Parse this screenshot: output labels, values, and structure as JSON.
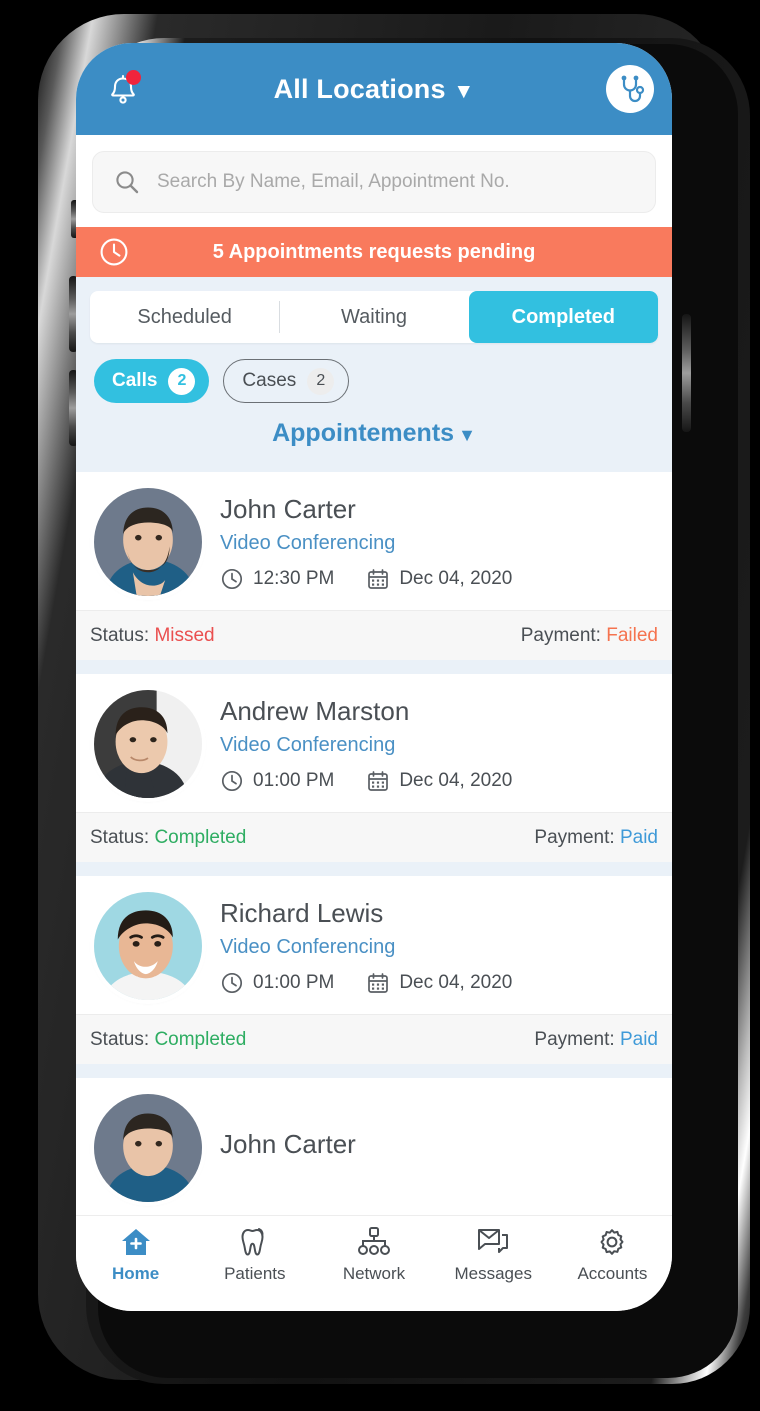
{
  "header": {
    "title": "All Locations",
    "caret": "▼",
    "bell_icon": "bell-icon",
    "logo_icon": "stethoscope-logo-icon"
  },
  "search": {
    "placeholder": "Search By Name, Email, Appointment No.",
    "value": "",
    "icon": "search-icon"
  },
  "pending_banner": {
    "count": "5",
    "text": "Appointments requests pending",
    "full_text": "5 Appointments requests pending",
    "icon": "clock-icon",
    "color": "#F97A5D"
  },
  "tabs": [
    {
      "label": "Scheduled",
      "active": false
    },
    {
      "label": "Waiting",
      "active": false
    },
    {
      "label": "Completed",
      "active": true
    }
  ],
  "chips": [
    {
      "label": "Calls",
      "badge": "2",
      "active": true
    },
    {
      "label": "Cases",
      "badge": "2",
      "active": false
    }
  ],
  "section": {
    "label": "Appointements",
    "caret": "▼"
  },
  "appointments": [
    {
      "name": "John Carter",
      "type": "Video Conferencing",
      "time": "12:30 PM",
      "date": "Dec 04, 2020",
      "status_label": "Status:",
      "status_value": "Missed",
      "status_class": "status-missed",
      "payment_label": "Payment:",
      "payment_value": "Failed",
      "payment_class": "pay-failed",
      "avatar_bg": "#6e7a8c",
      "avatar_skin": "#e9c4a8",
      "avatar_hair": "#2c2620",
      "avatar_shirt": "#1f5f86"
    },
    {
      "name": "Andrew Marston",
      "type": "Video Conferencing",
      "time": "01:00 PM",
      "date": "Dec 04, 2020",
      "status_label": "Status:",
      "status_value": "Completed",
      "status_class": "status-completed",
      "payment_label": "Payment:",
      "payment_value": "Paid",
      "payment_class": "pay-paid",
      "avatar_bg": "#3c3c3c",
      "avatar_skin": "#ecc9ad",
      "avatar_hair": "#2a211a",
      "avatar_shirt": "#2f3338"
    },
    {
      "name": "Richard Lewis",
      "type": "Video Conferencing",
      "time": "01:00 PM",
      "date": "Dec 04, 2020",
      "status_label": "Status:",
      "status_value": "Completed",
      "status_class": "status-completed",
      "payment_label": "Payment:",
      "payment_value": "Paid",
      "payment_class": "pay-paid",
      "avatar_bg": "#9fd8e3",
      "avatar_skin": "#e8b795",
      "avatar_hair": "#241c16",
      "avatar_shirt": "#f4f4f4"
    },
    {
      "name": "John Carter",
      "type": "",
      "time": "",
      "date": "",
      "status_label": "",
      "status_value": "",
      "status_class": "",
      "payment_label": "",
      "payment_value": "",
      "payment_class": "",
      "avatar_bg": "#6e7a8c",
      "avatar_skin": "#e9c4a8",
      "avatar_hair": "#2c2620",
      "avatar_shirt": "#1f5f86"
    }
  ],
  "bottom_nav": [
    {
      "label": "Home",
      "icon": "home-plus-icon",
      "active": true
    },
    {
      "label": "Patients",
      "icon": "tooth-icon",
      "active": false
    },
    {
      "label": "Network",
      "icon": "org-chart-icon",
      "active": false
    },
    {
      "label": "Messages",
      "icon": "envelope-chat-icon",
      "active": false
    },
    {
      "label": "Accounts",
      "icon": "gear-icon",
      "active": false
    }
  ],
  "colors": {
    "header_blue": "#3C8DC5",
    "accent_cyan": "#32C0E0",
    "banner_orange": "#F97A5D",
    "page_bg": "#EAF1F8",
    "link_blue": "#4A90C4",
    "success_green": "#2EAD62",
    "danger_red": "#EA4F4F"
  }
}
